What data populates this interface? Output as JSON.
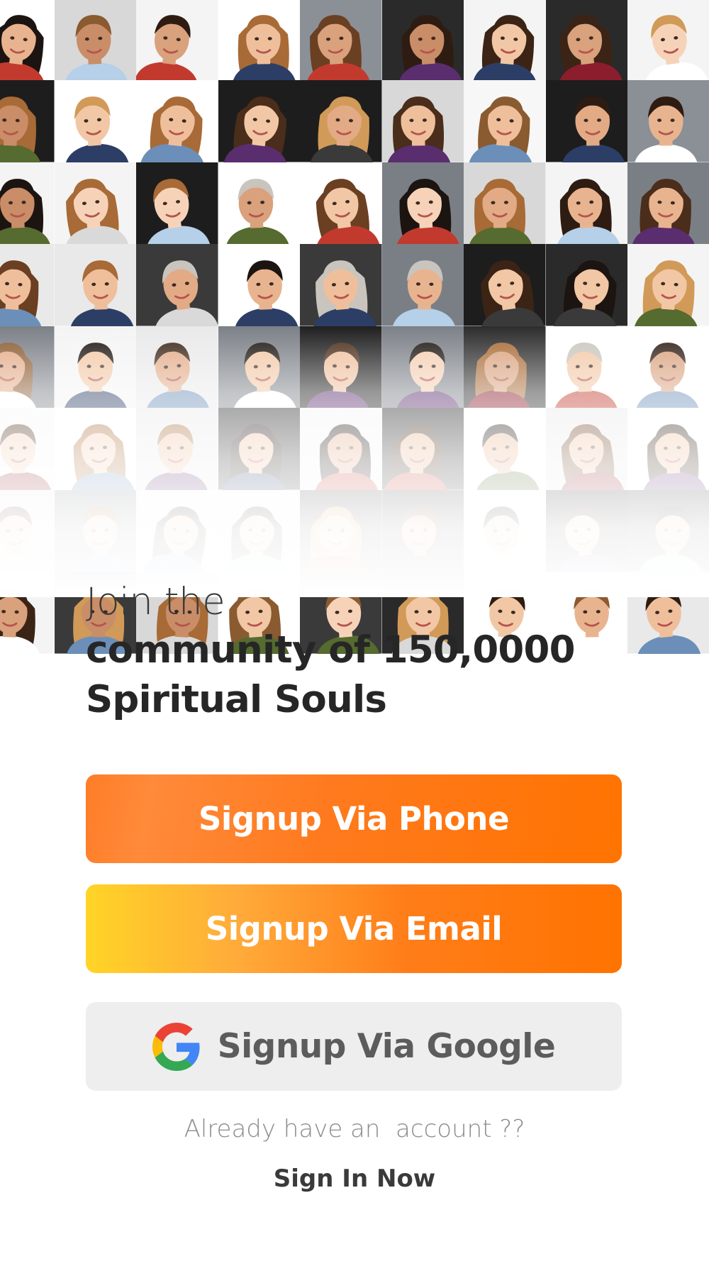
{
  "headline": {
    "line1": "Join the",
    "line2": "community of 150,0000",
    "line3": "Spiritual Souls"
  },
  "buttons": {
    "phone": "Signup Via Phone",
    "email": "Signup Via Email",
    "google": "Signup Via Google"
  },
  "footer": {
    "prompt": "Already have an  account ??",
    "signin": "Sign In Now"
  },
  "colors": {
    "accent_orange": "#ff7300",
    "accent_yellow": "#ffd426",
    "google_button_bg": "#eeeeee",
    "text_dark": "#2b2b2b"
  },
  "icons": {
    "google": "google-g-icon"
  }
}
